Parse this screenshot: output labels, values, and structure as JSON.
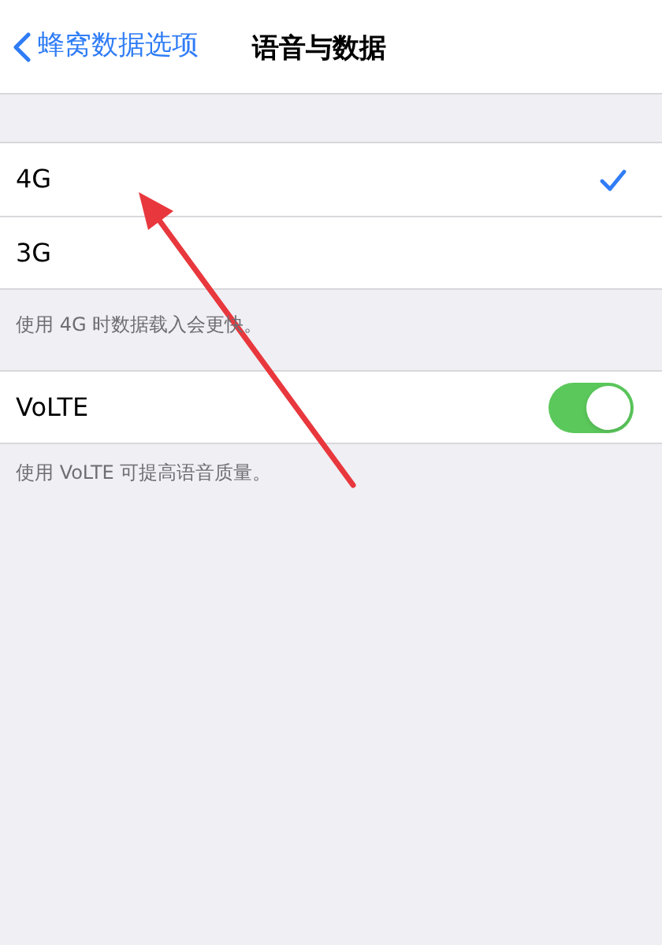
{
  "nav": {
    "back_label": "蜂窝数据选项",
    "title": "语音与数据"
  },
  "network_options": [
    {
      "label": "4G",
      "selected": true
    },
    {
      "label": "3G",
      "selected": false
    }
  ],
  "network_footer": "使用 4G 时数据载入会更快。",
  "volte": {
    "label": "VoLTE",
    "on": true
  },
  "volte_footer": "使用 VoLTE 可提高语音质量。"
}
